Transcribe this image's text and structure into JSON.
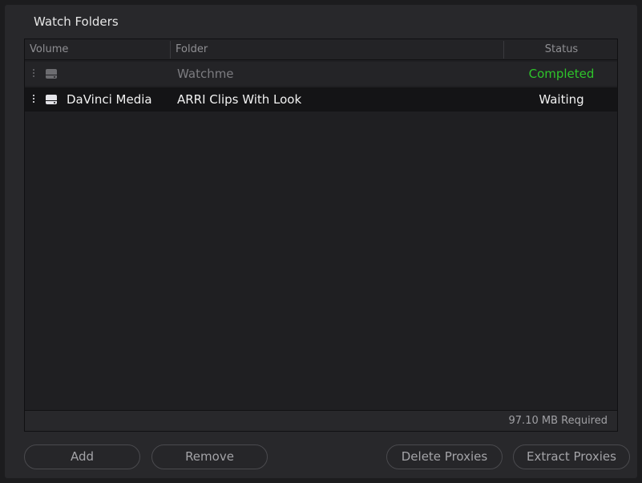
{
  "dialog": {
    "title": "Watch Folders"
  },
  "table": {
    "columns": {
      "volume": "Volume",
      "folder": "Folder",
      "status": "Status"
    },
    "rows": [
      {
        "volume": "",
        "folder": "Watchme",
        "status": "Completed",
        "state": "dimmed",
        "icon": "drive-icon"
      },
      {
        "volume": "DaVinci Media",
        "folder": "ARRI Clips With Look",
        "status": "Waiting",
        "state": "selected",
        "icon": "drive-icon"
      }
    ],
    "footer": {
      "required": "97.10 MB Required"
    }
  },
  "buttons": {
    "add": "Add",
    "remove": "Remove",
    "delete_proxies": "Delete Proxies",
    "extract_proxies": "Extract Proxies"
  },
  "colors": {
    "completed": "#2ec52a",
    "background": "#28282b",
    "selected_row": "#141416"
  }
}
